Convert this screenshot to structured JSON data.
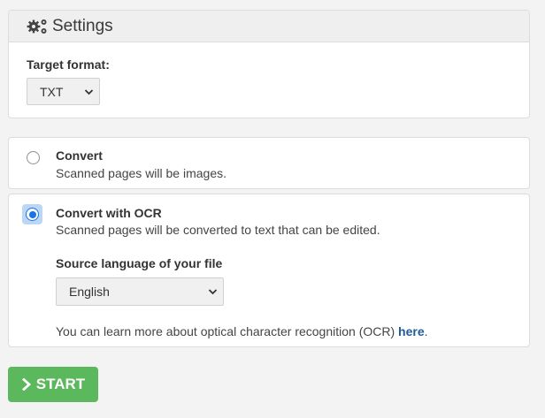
{
  "settings": {
    "title": "Settings",
    "icon": "gears-icon",
    "target_format_label": "Target format:",
    "target_format_value": "TXT"
  },
  "options": {
    "convert": {
      "title": "Convert",
      "description": "Scanned pages will be images.",
      "selected": false
    },
    "ocr": {
      "title": "Convert with OCR",
      "description": "Scanned pages will be converted to text that can be edited.",
      "selected": true,
      "source_language_label": "Source language of your file",
      "source_language_value": "English",
      "learn_more_prefix": "You can learn more about optical character recognition (OCR) ",
      "learn_more_link": "here",
      "learn_more_suffix": "."
    }
  },
  "start_button": {
    "label": "START",
    "icon": "chevron-right-icon",
    "color": "#5cb85c"
  },
  "colors": {
    "accent": "#1a73e8",
    "link": "#1e5a9a"
  }
}
